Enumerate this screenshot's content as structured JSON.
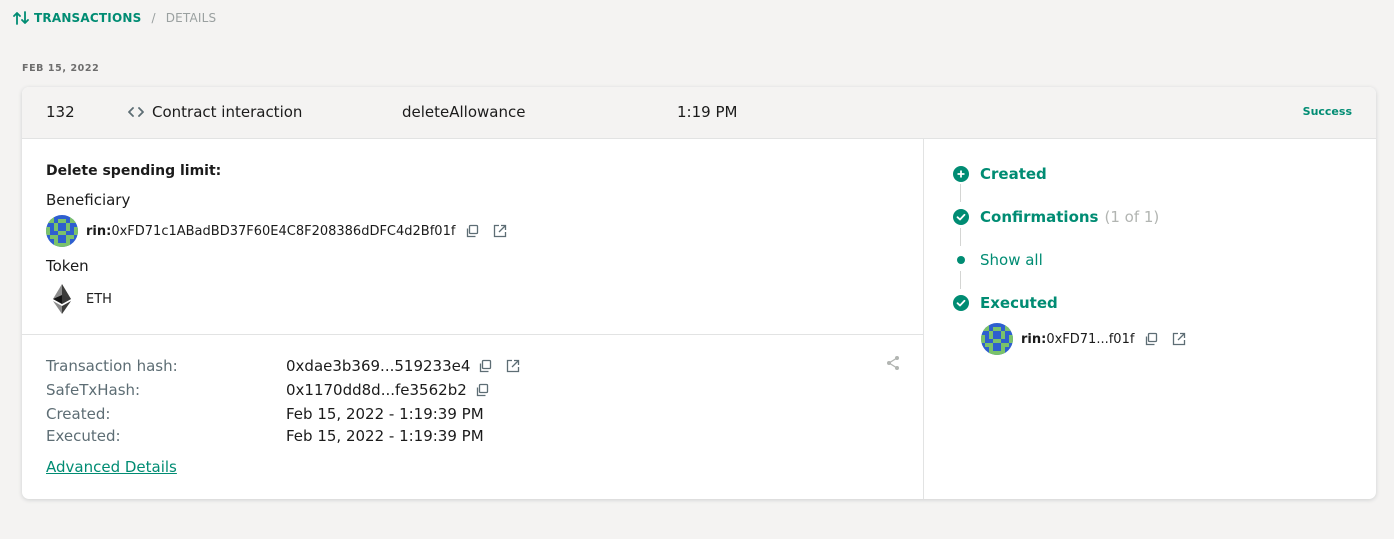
{
  "breadcrumb": {
    "section": "TRANSACTIONS",
    "separator": "/",
    "current": "DETAILS"
  },
  "date_label": "FEB 15, 2022",
  "tx": {
    "nonce": "132",
    "type": "Contract interaction",
    "method": "deleteAllowance",
    "time": "1:19 PM",
    "status": "Success",
    "status_color": "#008c73"
  },
  "details": {
    "title": "Delete spending limit:",
    "beneficiary_label": "Beneficiary",
    "beneficiary_prefix": "rin:",
    "beneficiary_address": "0xFD71c1ABadBD37F60E4C8F208386dDFC4d2Bf01f",
    "token_label": "Token",
    "token_symbol": "ETH"
  },
  "info": {
    "tx_hash_label": "Transaction hash:",
    "tx_hash_value": "0xdae3b369...519233e4",
    "safe_hash_label": "SafeTxHash:",
    "safe_hash_value": "0x1170dd8d...fe3562b2",
    "created_label": "Created:",
    "created_value": "Feb 15, 2022 - 1:19:39 PM",
    "executed_label": "Executed:",
    "executed_value": "Feb 15, 2022 - 1:19:39 PM",
    "advanced_link": "Advanced Details"
  },
  "timeline": {
    "created": "Created",
    "confirmations": "Confirmations",
    "confirmations_count": "(1 of 1)",
    "show_all": "Show all",
    "executed": "Executed",
    "signer_prefix": "rin:",
    "signer_address": "0xFD71...f01f"
  },
  "colors": {
    "accent": "#008c73",
    "background": "#f4f3f2",
    "muted": "#5d6d74"
  },
  "icons": [
    "transactions-icon",
    "code-icon",
    "copy-icon",
    "external-link-icon",
    "eth-icon",
    "share-icon",
    "plus-circle-icon",
    "check-circle-icon",
    "dot-icon",
    "identicon"
  ]
}
